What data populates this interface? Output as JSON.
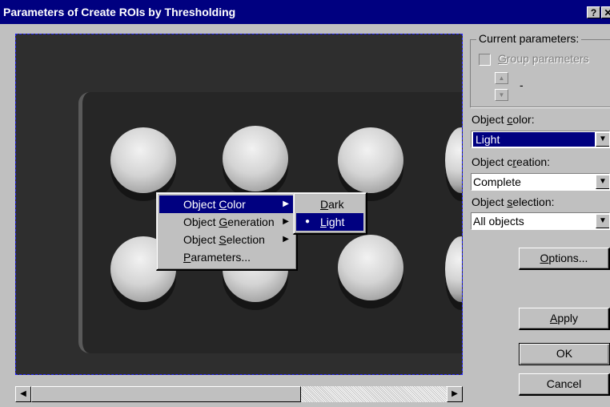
{
  "window": {
    "title": "Parameters of Create ROIs by Thresholding",
    "help_label": "?",
    "close_label": "✕"
  },
  "context_menu": {
    "items": [
      {
        "pre": "Object ",
        "key": "C",
        "post": "olor"
      },
      {
        "pre": "Object ",
        "key": "G",
        "post": "eneration"
      },
      {
        "pre": "Object ",
        "key": "S",
        "post": "election"
      },
      {
        "pre": "",
        "key": "P",
        "post": "arameters..."
      }
    ],
    "submenu": [
      {
        "pre": "",
        "key": "D",
        "post": "ark"
      },
      {
        "pre": "",
        "key": "L",
        "post": "ight"
      }
    ]
  },
  "panel": {
    "current_parameters_label": "Current parameters:",
    "group_parameters": {
      "pre": "",
      "key": "G",
      "post": "roup parameters"
    },
    "dash": "-",
    "object_color": {
      "pre": "Object ",
      "key": "c",
      "post": "olor:",
      "value": "Light"
    },
    "object_creation": {
      "pre": "Object c",
      "key": "r",
      "post": "eation:",
      "value": "Complete"
    },
    "object_selection": {
      "pre": "Object ",
      "key": "s",
      "post": "election:",
      "value": "All objects"
    }
  },
  "buttons": {
    "options": {
      "pre": "",
      "key": "O",
      "post": "ptions..."
    },
    "apply": {
      "pre": "",
      "key": "A",
      "post": "pply"
    },
    "ok": "OK",
    "cancel": "Cancel"
  }
}
